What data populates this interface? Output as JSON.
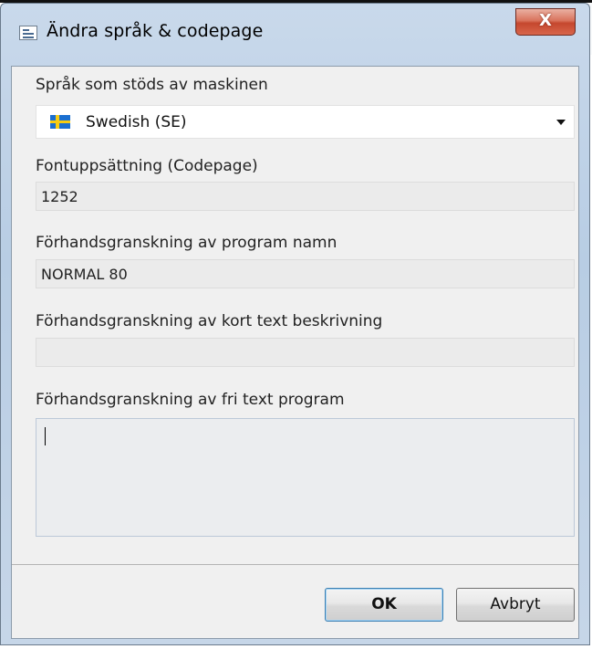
{
  "window": {
    "title": "Ändra språk & codepage",
    "close_label": "X"
  },
  "fields": {
    "language": {
      "label": "Språk som stöds av maskinen",
      "value": "Swedish (SE)"
    },
    "codepage": {
      "label": "Fontuppsättning (Codepage)",
      "value": "1252"
    },
    "program_name": {
      "label": "Förhandsgranskning av program namn",
      "value": "NORMAL 80"
    },
    "short_desc": {
      "label": "Förhandsgranskning av kort text beskrivning",
      "value": ""
    },
    "free_text": {
      "label": "Förhandsgranskning av fri text program",
      "value": ""
    }
  },
  "buttons": {
    "ok": "OK",
    "cancel": "Avbryt"
  },
  "icons": {
    "title": "dialog-window-icon",
    "flag": "sweden-flag-icon",
    "dropdown": "chevron-down-icon"
  },
  "colors": {
    "close_button": "#c5472e",
    "flag_blue": "#1b6fd0",
    "flag_yellow": "#f7cc12",
    "default_button_border": "#3c7fb1"
  }
}
